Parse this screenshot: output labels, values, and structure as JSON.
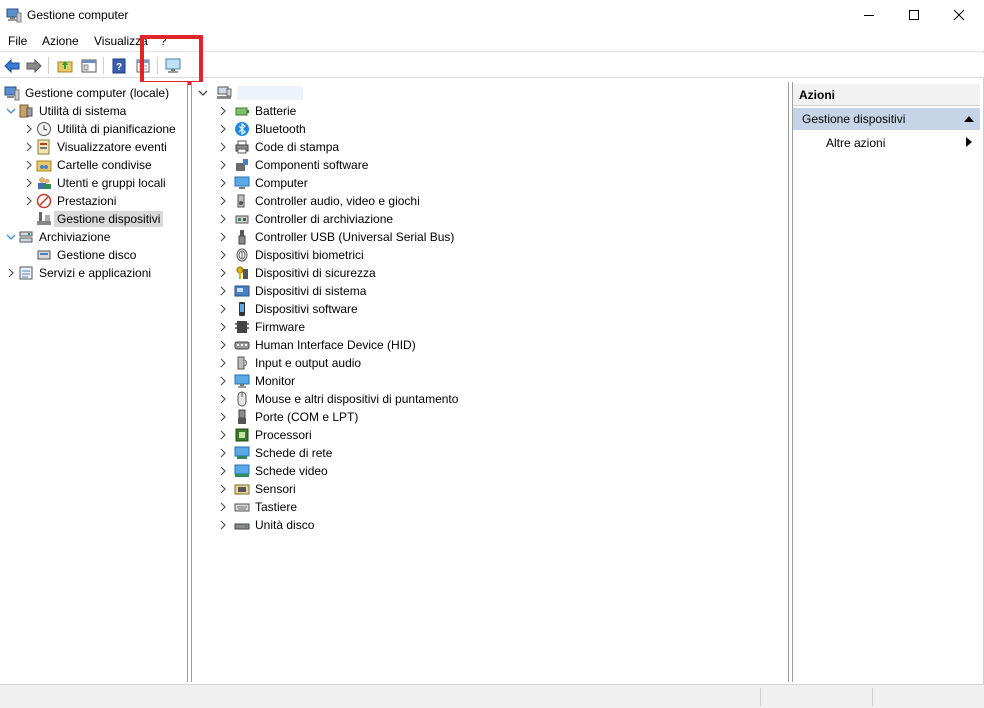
{
  "window": {
    "title": "Gestione computer"
  },
  "menu": [
    "File",
    "Azione",
    "Visualizza",
    "?"
  ],
  "toolbar": {
    "buttons": [
      "back-icon",
      "forward-icon",
      "up-folder-icon",
      "show-hide-tree-icon",
      "help-icon",
      "properties-icon",
      "monitor-icon"
    ],
    "highlighted": "monitor-icon",
    "highlight_color": "#e3242b"
  },
  "tree": {
    "root": "Gestione computer (locale)",
    "items": [
      {
        "label": "Utilità di sistema",
        "expanded": true
      },
      {
        "label": "Utilità di pianificazione"
      },
      {
        "label": "Visualizzatore eventi"
      },
      {
        "label": "Cartelle condivise"
      },
      {
        "label": "Utenti e gruppi locali"
      },
      {
        "label": "Prestazioni"
      },
      {
        "label": "Gestione dispositivi",
        "selected": true
      },
      {
        "label": "Archiviazione",
        "expanded": true
      },
      {
        "label": "Gestione disco"
      },
      {
        "label": "Servizi e applicazioni"
      }
    ]
  },
  "devices": {
    "root_icon": "computer-icon",
    "categories": [
      "Batterie",
      "Bluetooth",
      "Code di stampa",
      "Componenti software",
      "Computer",
      "Controller audio, video e giochi",
      "Controller di archiviazione",
      "Controller USB (Universal Serial Bus)",
      "Dispositivi biometrici",
      "Dispositivi di sicurezza",
      "Dispositivi di sistema",
      "Dispositivi software",
      "Firmware",
      "Human Interface Device (HID)",
      "Input e output audio",
      "Monitor",
      "Mouse e altri dispositivi di puntamento",
      "Porte (COM e LPT)",
      "Processori",
      "Schede di rete",
      "Schede video",
      "Sensori",
      "Tastiere",
      "Unità disco"
    ]
  },
  "actions": {
    "header": "Azioni",
    "section": "Gestione dispositivi",
    "more": "Altre azioni"
  }
}
